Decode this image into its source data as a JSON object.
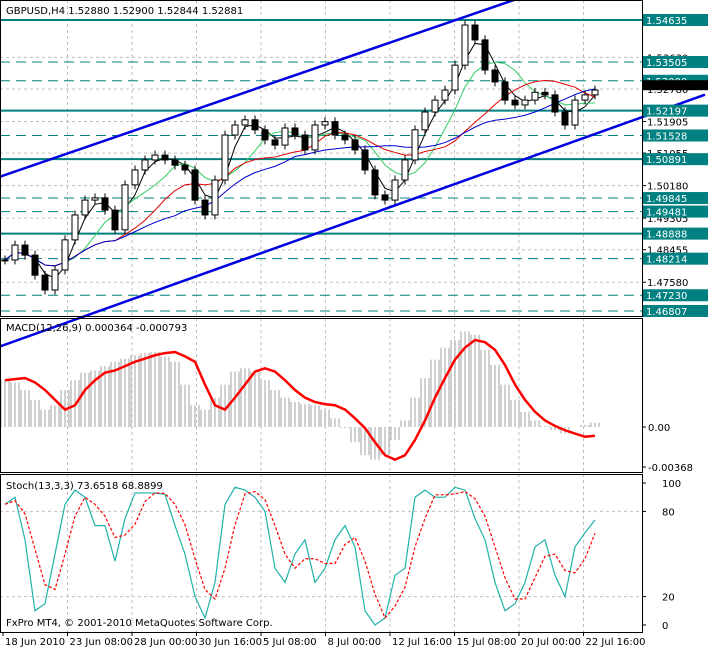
{
  "header": {
    "symbol_label": "GBPUSD,H4  1.52880 1.52900 1.52844 1.52881"
  },
  "copyright": "FxPro MT4, © 2001-2010 MetaQuotes Software Corp.",
  "colors": {
    "bull": "#000000",
    "bear": "#000000",
    "level": "#008080",
    "trend": "#0000e0",
    "ma_black": "#000000",
    "ma_green": "#33cc66",
    "ma_red": "#e00000",
    "ma_blue": "#0000cc",
    "macd_hist": "#c0c0c0",
    "macd_signal": "#ff0000",
    "stoch_main": "#20b2aa",
    "stoch_signal": "#ff0000"
  },
  "chart_data": [
    {
      "type": "candlestick",
      "title": "GBPUSD,H4",
      "ylim": [
        1.4672,
        1.5515
      ],
      "current_price": "1.52881",
      "x_tick_labels": [
        "18 Jun 2010",
        "23 Jun 08:00",
        "28 Jun 00:00",
        "30 Jun 16:00",
        "5 Jul 08:00",
        "8 Jul 00:00",
        "12 Jul 16:00",
        "15 Jul 08:00",
        "20 Jul 00:00",
        "22 Jul 16:00"
      ],
      "y_tick_labels": [
        "1.53630",
        "1.52780",
        "1.51905",
        "1.51055",
        "1.50180",
        "1.49305",
        "1.48455",
        "1.47580"
      ],
      "close": [
        1.4818,
        1.4858,
        1.4831,
        1.4777,
        1.4737,
        1.4791,
        1.4872,
        1.4939,
        1.4979,
        1.4985,
        1.4952,
        1.4899,
        1.502,
        1.506,
        1.5087,
        1.51,
        1.5087,
        1.5073,
        1.506,
        1.4979,
        1.4939,
        1.5033,
        1.5154,
        1.5181,
        1.5195,
        1.5168,
        1.5141,
        1.5127,
        1.5173,
        1.5154,
        1.5114,
        1.5181,
        1.519,
        1.5154,
        1.5141,
        1.5114,
        1.506,
        1.4993,
        1.4979,
        1.5033,
        1.5087,
        1.5168,
        1.5216,
        1.5248,
        1.5275,
        1.5342,
        1.545,
        1.541,
        1.5329,
        1.5297,
        1.5248,
        1.5235,
        1.5248,
        1.5269,
        1.5262,
        1.5216,
        1.5181,
        1.5248,
        1.5262,
        1.5275
      ],
      "levels": [
        {
          "price": "1.54635",
          "style": "solid"
        },
        {
          "price": "1.53505",
          "style": "dashed"
        },
        {
          "price": "1.53000",
          "style": "dashed"
        },
        {
          "price": "1.52197",
          "style": "solid"
        },
        {
          "price": "1.51528",
          "style": "dashed"
        },
        {
          "price": "1.50891",
          "style": "solid"
        },
        {
          "price": "1.49845",
          "style": "dashed"
        },
        {
          "price": "1.49481",
          "style": "dashed"
        },
        {
          "price": "1.48888",
          "style": "solid"
        },
        {
          "price": "1.48214",
          "style": "dashed"
        },
        {
          "price": "1.47230",
          "style": "dashed"
        },
        {
          "price": "1.46807",
          "style": "dashed"
        }
      ],
      "trendlines": [
        {
          "from": [
            -0.5,
            1.5042
          ],
          "to": [
            50,
            1.5509
          ]
        },
        {
          "from": [
            8,
            1.4667
          ],
          "to": [
            66.3,
            1.5227
          ]
        }
      ]
    },
    {
      "type": "bar+line",
      "title": "MACD(12,26,9) 0.000364 -0.000793",
      "ylim": [
        -0.0045,
        0.01
      ],
      "y_tick_labels": [
        "0.00",
        "-0.00368"
      ],
      "main": [
        0.0044,
        0.0041,
        0.0034,
        0.0025,
        0.0016,
        0.002,
        0.0034,
        0.0043,
        0.005,
        0.0052,
        0.0056,
        0.006,
        0.0063,
        0.0066,
        0.0068,
        0.0069,
        0.0065,
        0.006,
        0.0039,
        0.002,
        0.0016,
        0.0027,
        0.0039,
        0.0051,
        0.0054,
        0.0051,
        0.0043,
        0.0034,
        0.0027,
        0.0023,
        0.0021,
        0.002,
        0.0016,
        0.0008,
        -0.0001,
        -0.0014,
        -0.0026,
        -0.003,
        -0.0026,
        -0.0012,
        0.0006,
        0.0027,
        0.0045,
        0.0062,
        0.0073,
        0.008,
        0.0088,
        0.0085,
        0.0071,
        0.0057,
        0.0039,
        0.0025,
        0.0014,
        0.0006,
        0.0001,
        -0.0003,
        -0.0006,
        0.0,
        0.0002,
        0.0004
      ],
      "signal": [
        0.0043,
        0.0044,
        0.0045,
        0.0041,
        0.0034,
        0.0025,
        0.0016,
        0.002,
        0.0034,
        0.0043,
        0.005,
        0.0052,
        0.0056,
        0.006,
        0.0063,
        0.0066,
        0.0068,
        0.0069,
        0.0065,
        0.006,
        0.0039,
        0.002,
        0.0016,
        0.0027,
        0.0039,
        0.0051,
        0.0054,
        0.0051,
        0.0043,
        0.0034,
        0.0027,
        0.0023,
        0.0021,
        0.002,
        0.0016,
        0.0008,
        -0.0001,
        -0.0014,
        -0.0026,
        -0.003,
        -0.0026,
        -0.0012,
        0.0006,
        0.0027,
        0.0045,
        0.0062,
        0.0073,
        0.008,
        0.0078,
        0.0071,
        0.0057,
        0.0039,
        0.0025,
        0.0014,
        0.0006,
        0.0001,
        -0.0003,
        -0.0006,
        -0.0009,
        -0.0008
      ]
    },
    {
      "type": "line",
      "title": "Stoch(13,3,3) 73.6518 68.8899",
      "ylim": [
        0,
        100
      ],
      "y_tick_labels": [
        "100",
        "80",
        "20",
        "0"
      ],
      "main": [
        85,
        90,
        60,
        10,
        15,
        50,
        85,
        95,
        90,
        70,
        70,
        45,
        75,
        93,
        93,
        93,
        92,
        70,
        50,
        20,
        5,
        30,
        85,
        97,
        95,
        90,
        80,
        40,
        30,
        50,
        60,
        30,
        40,
        60,
        70,
        55,
        10,
        0,
        5,
        35,
        40,
        90,
        95,
        90,
        90,
        97,
        95,
        75,
        60,
        30,
        10,
        15,
        30,
        55,
        60,
        35,
        20,
        55,
        65,
        74
      ]
    }
  ]
}
